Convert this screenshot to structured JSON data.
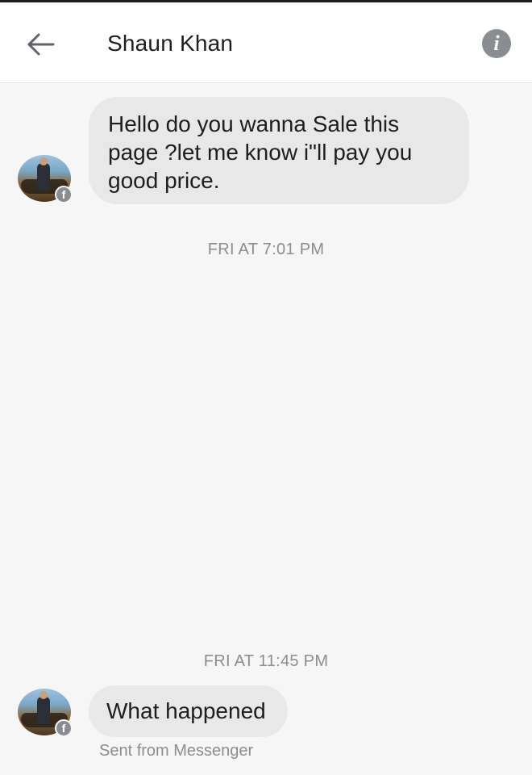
{
  "header": {
    "back_icon": "arrow-left-icon",
    "title": "Shaun Khan",
    "info_icon": "info-icon",
    "info_glyph": "i"
  },
  "conversation": {
    "messages": [
      {
        "sender": "Shaun Khan",
        "text": "Hello do you wanna Sale this page ?let me know i\"ll pay you good price."
      },
      {
        "sender": "Shaun Khan",
        "text": "What happened",
        "footer": "Sent from Messenger"
      }
    ],
    "timestamps": [
      "FRI AT 7:01 PM",
      "FRI AT 11:45 PM"
    ]
  },
  "colors": {
    "header_bg": "#ffffff",
    "chat_bg": "#f6f6f6",
    "bubble_bg": "#e8e8e8",
    "muted_text": "#8a8d91"
  }
}
